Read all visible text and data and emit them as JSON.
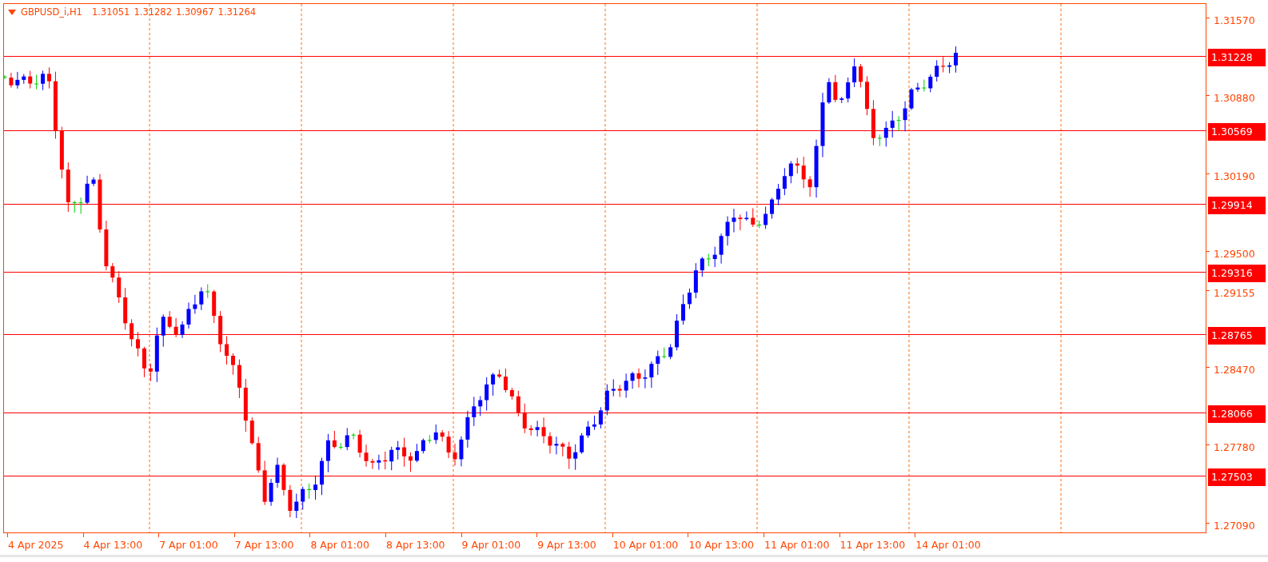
{
  "chart": {
    "title": "GBPUSD_i,H1",
    "ohlc": [
      "1.31051",
      "1.31282",
      "1.30967",
      "1.31264"
    ]
  },
  "price_axis": {
    "ticks": [
      "1.31570",
      "1.30880",
      "1.30190",
      "1.29500",
      "1.29155",
      "1.28470",
      "1.27780",
      "1.27090"
    ]
  },
  "levels": [
    "1.31228",
    "1.30569",
    "1.29914",
    "1.29316",
    "1.28765",
    "1.28066",
    "1.27503"
  ],
  "time_axis": {
    "labels": [
      "4 Apr 2025",
      "4 Apr 13:00",
      "7 Apr 01:00",
      "7 Apr 13:00",
      "8 Apr 01:00",
      "8 Apr 13:00",
      "9 Apr 01:00",
      "9 Apr 13:00",
      "10 Apr 01:00",
      "10 Apr 13:00",
      "11 Apr 01:00",
      "11 Apr 13:00",
      "14 Apr 01:00"
    ]
  }
}
